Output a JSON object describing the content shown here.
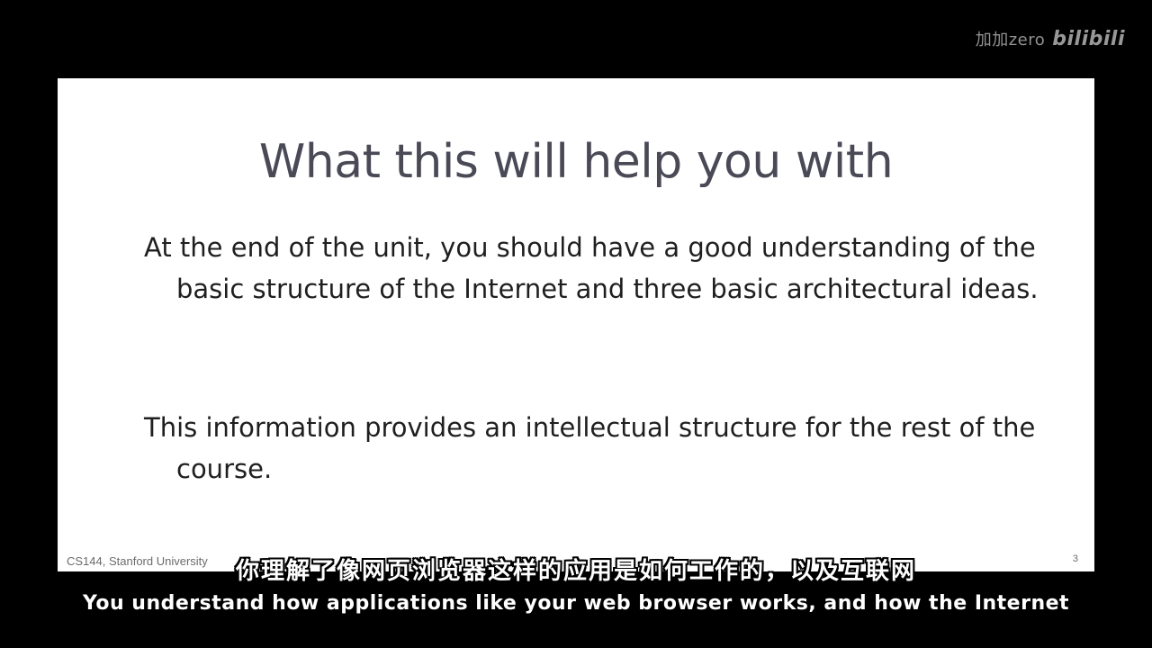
{
  "watermark": {
    "user": "加加zero",
    "logo": "bilibili"
  },
  "slide": {
    "title": "What this will help you with",
    "bullets": [
      "At the end of the unit, you should have a good understanding of the basic structure of the Internet and three basic architectural ideas.",
      "This information provides an intellectual structure for the rest of the course."
    ],
    "footer_left": "CS144, Stanford University",
    "page_number": "3"
  },
  "subtitles": {
    "zh": "你理解了像网页浏览器这样的应用是如何工作的，以及互联网",
    "en": "You understand how applications like your web browser works, and how the Internet"
  }
}
